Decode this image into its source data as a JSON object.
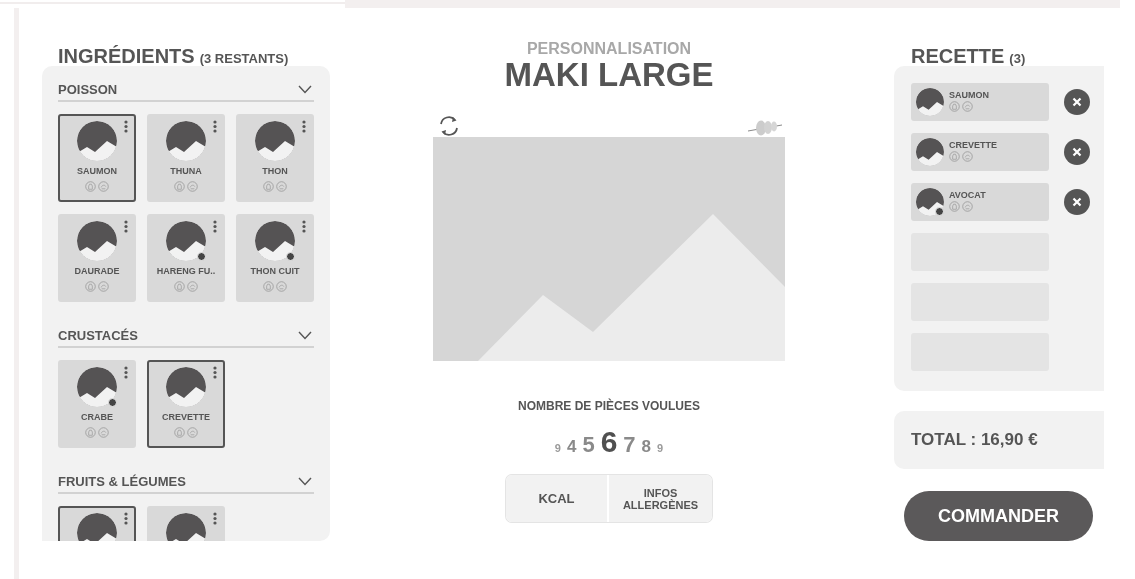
{
  "ingredients": {
    "title": "INGRÉDIENTS",
    "remaining": "(3 RESTANTS)",
    "sections": [
      {
        "title": "POISSON",
        "expanded": true,
        "items": [
          {
            "name": "SAUMON",
            "selected": true,
            "badge": false
          },
          {
            "name": "THUNA",
            "selected": false,
            "badge": false
          },
          {
            "name": "THON",
            "selected": false,
            "badge": false
          },
          {
            "name": "DAURADE",
            "selected": false,
            "badge": false
          },
          {
            "name": "HARENG FU..",
            "selected": false,
            "badge": true
          },
          {
            "name": "THON CUIT",
            "selected": false,
            "badge": true
          }
        ]
      },
      {
        "title": "CRUSTACÉS",
        "expanded": true,
        "items": [
          {
            "name": "CRABE",
            "selected": false,
            "badge": true
          },
          {
            "name": "CREVETTE",
            "selected": true,
            "badge": false
          }
        ]
      },
      {
        "title": "FRUITS & LÉGUMES",
        "expanded": true,
        "items": [
          {
            "selected": true
          },
          {
            "selected": false
          }
        ]
      }
    ]
  },
  "customize": {
    "subtitle": "PERSONNALISATION",
    "title": "MAKI LARGE",
    "pieces_label": "NOMBRE DE PIÈCES VOULUES",
    "pieces": [
      {
        "label": "9",
        "selected": false
      },
      {
        "label": "4",
        "selected": false
      },
      {
        "label": "5",
        "selected": false
      },
      {
        "label": "6",
        "selected": true
      },
      {
        "label": "7",
        "selected": false
      },
      {
        "label": "8",
        "selected": false
      },
      {
        "label": "9",
        "selected": false
      }
    ],
    "buttons": [
      "KCAL",
      "INFOS ALLERGÈNES"
    ]
  },
  "recipe": {
    "title": "RECETTE",
    "count": "(3)",
    "slots": [
      {
        "kind": "ingredient",
        "name": "SAUMON",
        "badge": false
      },
      {
        "kind": "ingredient",
        "name": "CREVETTE",
        "badge": false
      },
      {
        "kind": "ingredient",
        "name": "AVOCAT",
        "badge": true
      },
      {
        "kind": "empty"
      },
      {
        "kind": "empty"
      },
      {
        "kind": "empty"
      }
    ],
    "total": "TOTAL : 16,90 €",
    "order_button": "COMMANDER"
  }
}
